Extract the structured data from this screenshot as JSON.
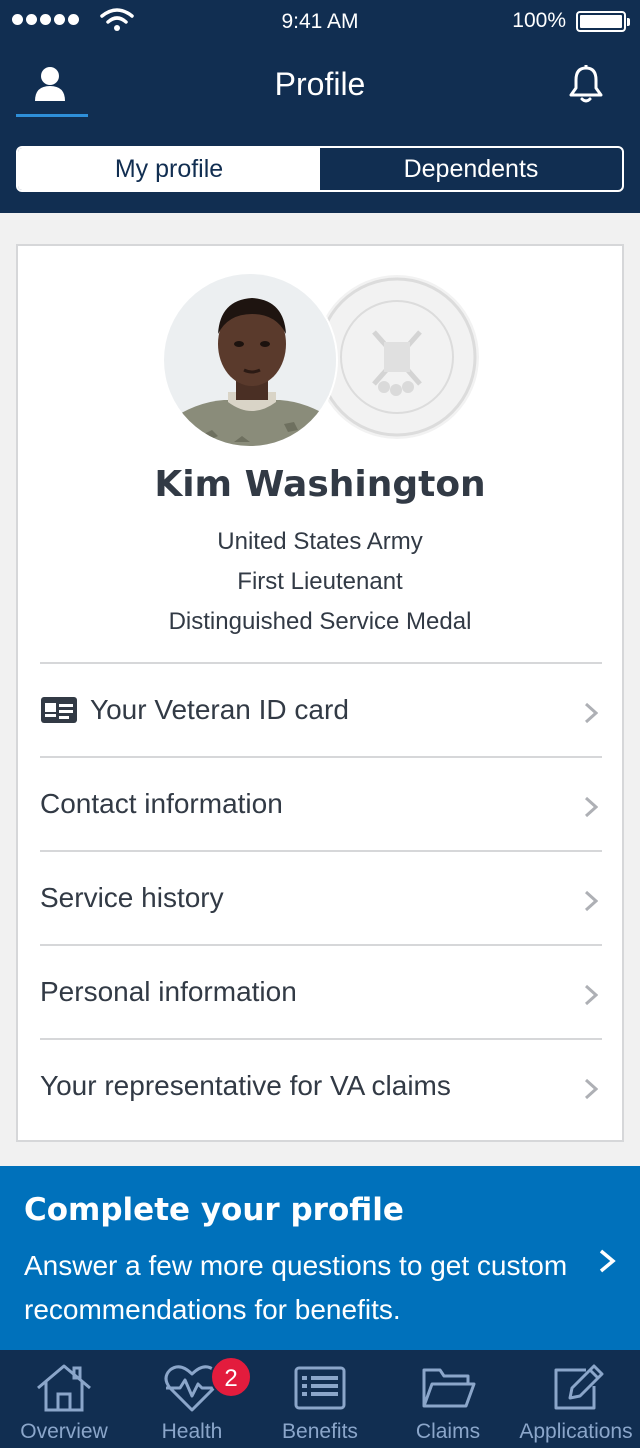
{
  "status_bar": {
    "time": "9:41 AM",
    "battery": "100%"
  },
  "header": {
    "title": "Profile"
  },
  "segments": {
    "my_profile": "My profile",
    "dependents": "Dependents",
    "selected": "My profile"
  },
  "profile": {
    "name": "Kim Washington",
    "branch": "United States Army",
    "rank": "First Lieutenant",
    "award": "Distinguished Service Medal",
    "seal_icon": "army-seal-icon"
  },
  "menu": [
    {
      "label": "Your Veteran ID card",
      "icon": "id-card-icon"
    },
    {
      "label": "Contact information"
    },
    {
      "label": "Service history"
    },
    {
      "label": "Personal information"
    },
    {
      "label": "Your representative for VA claims"
    }
  ],
  "banner": {
    "title": "Complete your profile",
    "text": "Answer a few more questions to get custom recommendations for benefits."
  },
  "tabs": [
    {
      "label": "Overview",
      "icon": "home-icon"
    },
    {
      "label": "Health",
      "icon": "heart-pulse-icon",
      "badge": "2"
    },
    {
      "label": "Benefits",
      "icon": "list-icon"
    },
    {
      "label": "Claims",
      "icon": "folder-icon"
    },
    {
      "label": "Applications",
      "icon": "edit-icon"
    }
  ],
  "colors": {
    "navy": "#112e51",
    "blue": "#0071bb",
    "badge_red": "#e31c3d",
    "tab_inactive": "#8ba6ca"
  }
}
